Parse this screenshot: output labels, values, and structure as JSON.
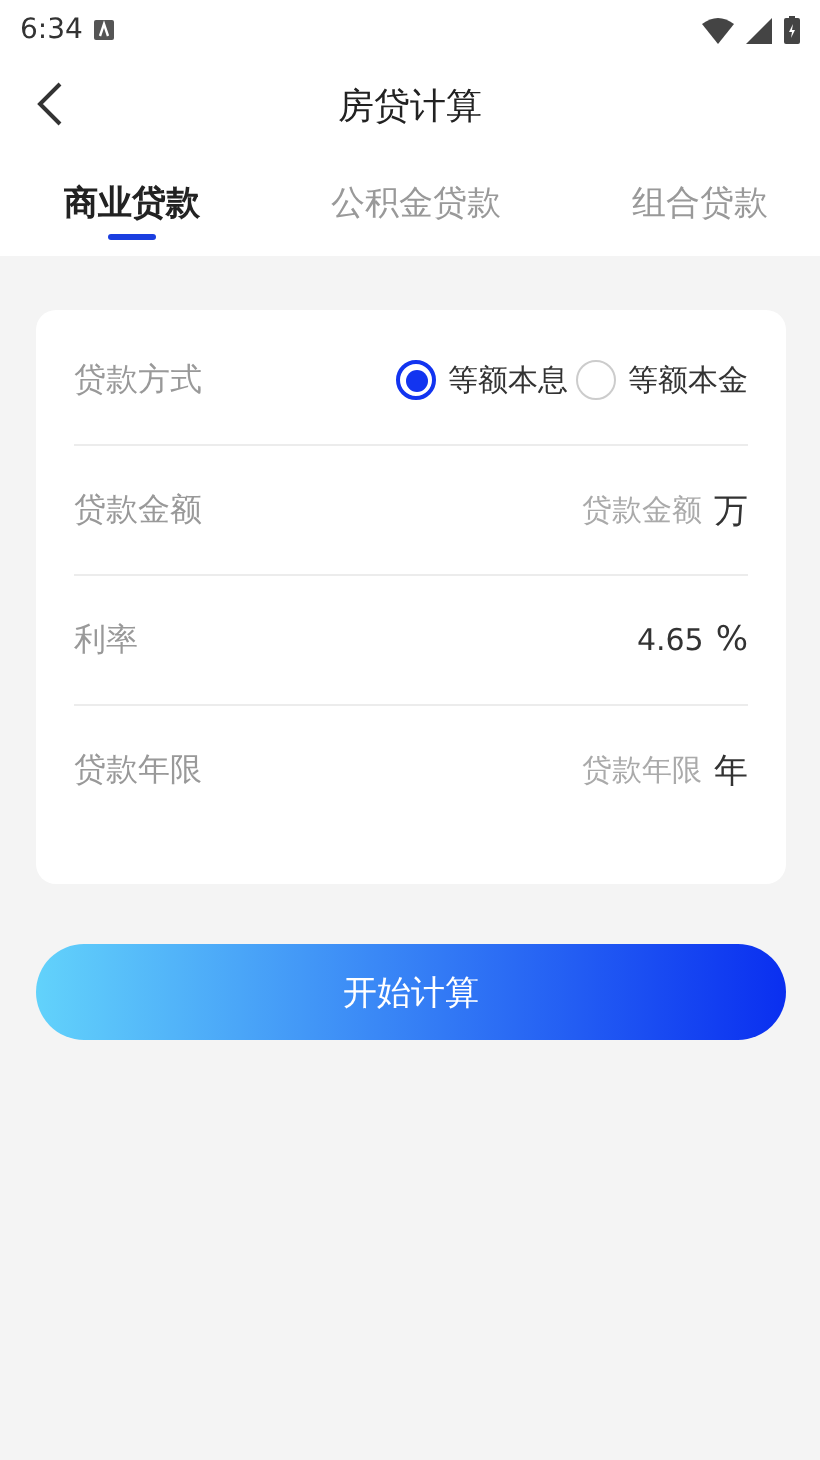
{
  "status_bar": {
    "time": "6:34"
  },
  "header": {
    "title": "房贷计算"
  },
  "tabs": [
    {
      "label": "商业贷款",
      "selected": true
    },
    {
      "label": "公积金贷款",
      "selected": false
    },
    {
      "label": "组合贷款",
      "selected": false
    }
  ],
  "form": {
    "rows": [
      {
        "kind": "radio",
        "label": "贷款方式",
        "options": [
          {
            "label": "等额本息",
            "selected": true
          },
          {
            "label": "等额本金",
            "selected": false
          }
        ]
      },
      {
        "kind": "input",
        "label": "贷款金额",
        "placeholder": "贷款金额",
        "unit": "万"
      },
      {
        "kind": "input",
        "label": "利率",
        "value": "4.65",
        "unit": "%"
      },
      {
        "kind": "input",
        "label": "贷款年限",
        "placeholder": "贷款年限",
        "unit": "年"
      }
    ]
  },
  "button": {
    "label": "开始计算"
  }
}
